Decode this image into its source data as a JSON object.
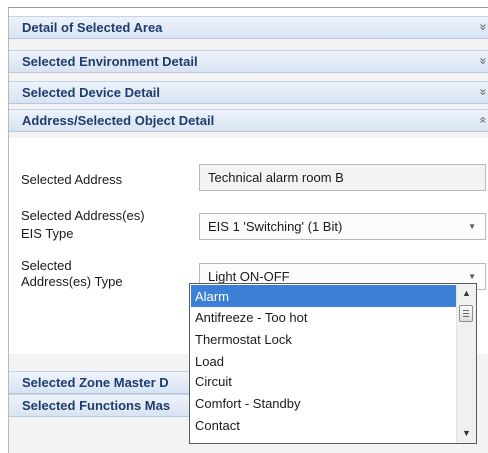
{
  "sections": [
    {
      "label": "Detail of Selected Area",
      "icon": "double-chevron-down-icon",
      "glyph": "»"
    },
    {
      "label": "Selected Environment Detail",
      "icon": "double-chevron-down-icon",
      "glyph": "»"
    },
    {
      "label": "Selected Device Detail",
      "icon": "double-chevron-down-icon",
      "glyph": "»"
    },
    {
      "label": "Address/Selected Object Detail",
      "icon": "double-chevron-up-icon",
      "glyph": "«"
    }
  ],
  "form": {
    "address_label": "Selected Address",
    "address_value": "Technical alarm room B",
    "eis_label_line1": "Selected Address(es)",
    "eis_label_line2": "EIS Type",
    "eis_value": "EIS 1 'Switching' (1 Bit)",
    "type_label_line1": "Selected",
    "type_label_line2": "Address(es) Type",
    "type_value": "Light ON-OFF"
  },
  "dropdown": {
    "options": [
      "Alarm",
      "Antifreeze - Too hot",
      "Thermostat Lock",
      "Load",
      "Circuit",
      "Comfort - Standby",
      "Contact"
    ],
    "selected": "Alarm"
  },
  "bottom_sections": [
    {
      "label": "Selected Zone Master D"
    },
    {
      "label": "Selected Functions Mas"
    }
  ],
  "colors": {
    "header_text": "#1e3d6e",
    "selection": "#3c7fd6"
  }
}
